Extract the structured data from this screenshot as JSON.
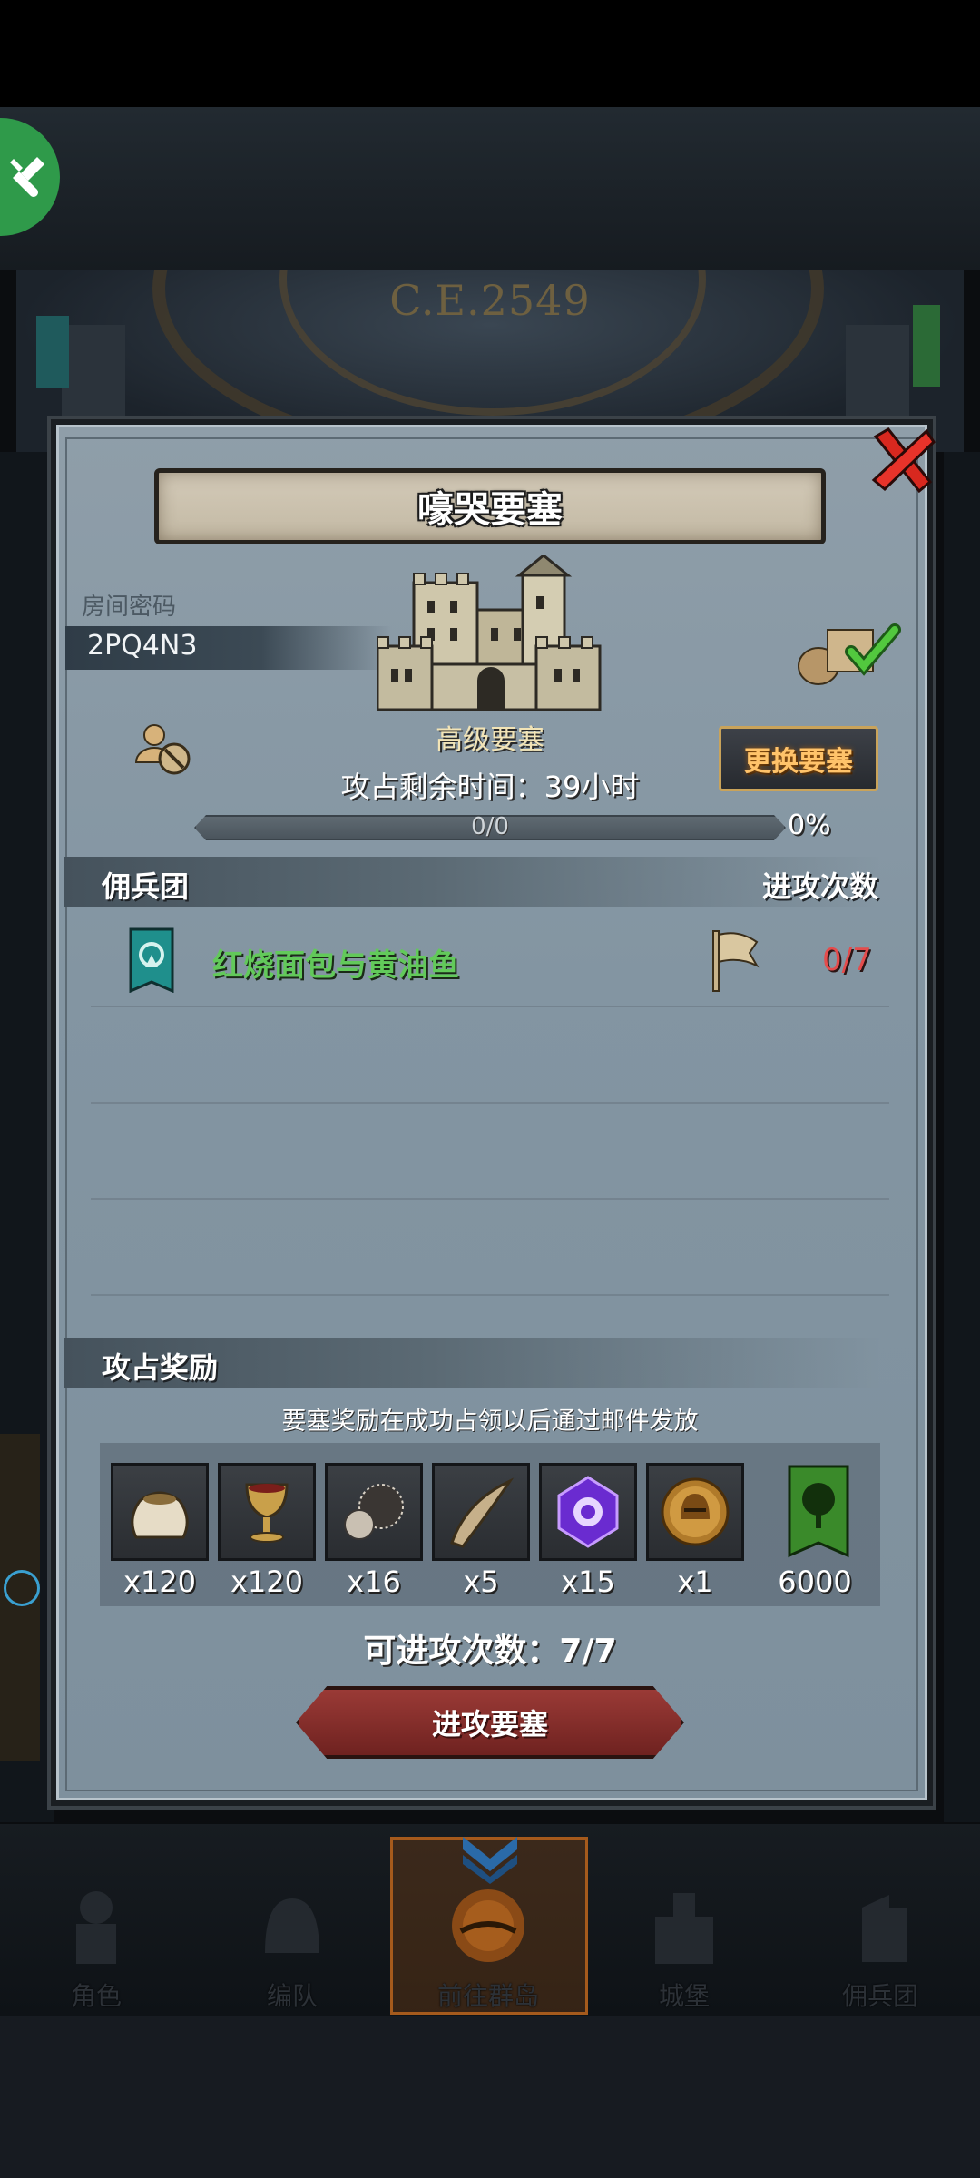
{
  "scene": {
    "era": "C.E.2549"
  },
  "popup": {
    "title": "嚎哭要塞",
    "room_label": "房间密码",
    "room_code": "2PQ4N3",
    "fortress_type": "高级要塞",
    "capture_time": "攻占剩余时间：39小时",
    "change_button": "更换要塞",
    "progress": {
      "text": "0/0",
      "percent_text": "0%",
      "value": 0
    },
    "mercenary_header": "佣兵团",
    "attack_count_header": "进攻次数",
    "mercenaries": [
      {
        "name": "红烧面包与黄油鱼",
        "attacks": "0/7"
      }
    ],
    "rewards_header": "攻占奖励",
    "reward_note": "要塞奖励在成功占领以后通过邮件发放",
    "rewards": [
      {
        "icon": "sack-icon",
        "qty": "x120"
      },
      {
        "icon": "goblet-icon",
        "qty": "x120"
      },
      {
        "icon": "truffle-icon",
        "qty": "x16"
      },
      {
        "icon": "horn-icon",
        "qty": "x5"
      },
      {
        "icon": "purple-crystal-icon",
        "qty": "x15"
      },
      {
        "icon": "helmet-coin-icon",
        "qty": "x1"
      },
      {
        "icon": "tree-banner-icon",
        "qty": "6000"
      }
    ],
    "available_attacks": "可进攻次数：7/7",
    "attack_button": "进攻要塞"
  },
  "nav": [
    {
      "label": "角色",
      "icon": "knight-icon"
    },
    {
      "label": "编队",
      "icon": "helmet-icon"
    },
    {
      "label": "前往群岛",
      "icon": "compass-icon",
      "active": true
    },
    {
      "label": "城堡",
      "icon": "castle-icon"
    },
    {
      "label": "佣兵团",
      "icon": "mercenary-icon"
    }
  ],
  "colors": {
    "accent_green": "#62c95a",
    "alert_red": "#e44c4c",
    "gold": "#ffc36a"
  }
}
